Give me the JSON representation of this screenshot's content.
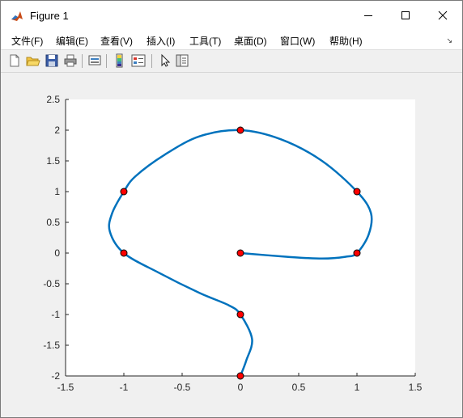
{
  "window": {
    "title": "Figure 1"
  },
  "menu": {
    "items": [
      "文件(F)",
      "编辑(E)",
      "查看(V)",
      "插入(I)",
      "工具(T)",
      "桌面(D)",
      "窗口(W)",
      "帮助(H)"
    ]
  },
  "toolbar": {
    "icons": [
      "new-figure-icon",
      "open-file-icon",
      "save-icon",
      "print-icon",
      "link-plot-icon",
      "colorbar-icon",
      "legend-icon",
      "edit-plot-arrow-icon",
      "property-inspector-icon"
    ]
  },
  "chart_data": {
    "type": "line",
    "title": "",
    "xlabel": "",
    "ylabel": "",
    "xlim": [
      -1.5,
      1.5
    ],
    "ylim": [
      -2,
      2.5
    ],
    "grid": false,
    "x_ticks": [
      "-1.5",
      "-1",
      "-0.5",
      "0",
      "0.5",
      "1",
      "1.5"
    ],
    "y_ticks": [
      "2.5",
      "2",
      "1.5",
      "1",
      "0.5",
      "0",
      "-0.5",
      "-1",
      "-1.5",
      "-2"
    ],
    "x_tick_values": [
      -1.5,
      -1,
      -0.5,
      0,
      0.5,
      1,
      1.5
    ],
    "y_tick_values": [
      2.5,
      2,
      1.5,
      1,
      0.5,
      0,
      -0.5,
      -1,
      -1.5,
      -2
    ],
    "line_color": "#0072bd",
    "marker_color": "#ff0000",
    "curve": {
      "x": [
        0,
        0.4,
        0.7,
        0.9,
        1.0,
        1.1,
        1.12,
        1.0,
        0.7,
        0.35,
        0,
        -0.35,
        -0.65,
        -0.9,
        -1.0,
        -1.1,
        -1.12,
        -1.0,
        -0.7,
        -0.35,
        -0.1,
        0,
        0.1,
        0.05,
        0
      ],
      "y": [
        0,
        -0.06,
        -0.09,
        -0.06,
        0,
        0.3,
        0.65,
        1.0,
        1.5,
        1.85,
        2.0,
        1.9,
        1.6,
        1.25,
        1.0,
        0.65,
        0.35,
        0,
        -0.32,
        -0.65,
        -0.85,
        -1.0,
        -1.4,
        -1.75,
        -2.0
      ]
    },
    "points": {
      "x": [
        0,
        1,
        1,
        0,
        -1,
        -1,
        0,
        0
      ],
      "y": [
        0,
        0,
        1,
        2,
        1,
        0,
        -1,
        -2
      ]
    }
  }
}
